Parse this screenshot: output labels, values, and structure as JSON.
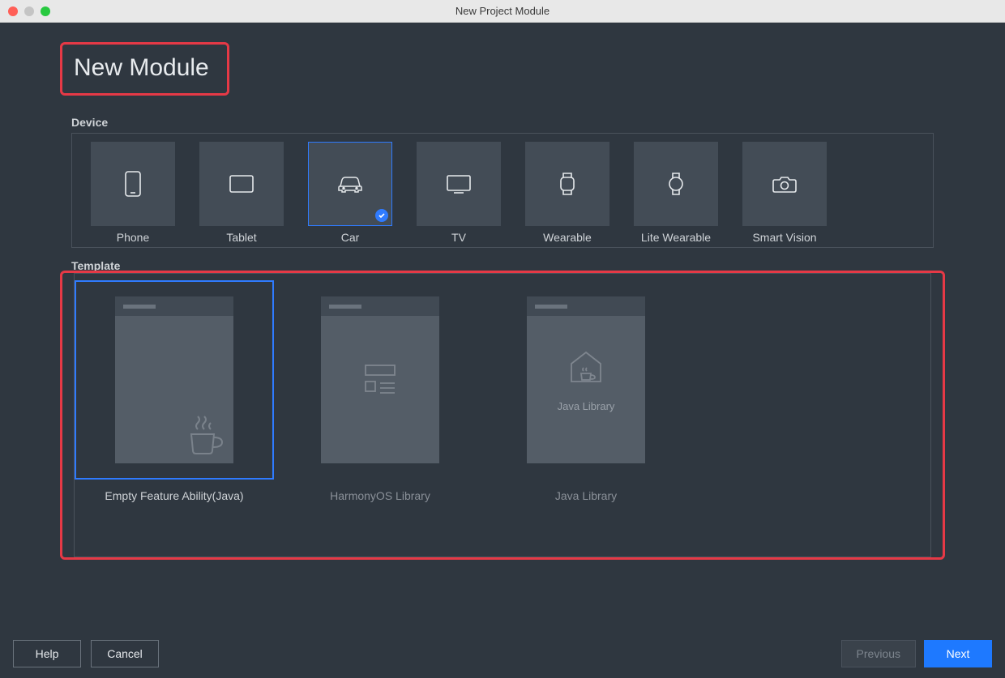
{
  "window": {
    "title": "New Project Module"
  },
  "heading": "New Module",
  "sections": {
    "device": "Device",
    "template": "Template"
  },
  "devices": [
    {
      "id": "phone",
      "label": "Phone",
      "selected": false
    },
    {
      "id": "tablet",
      "label": "Tablet",
      "selected": false
    },
    {
      "id": "car",
      "label": "Car",
      "selected": true
    },
    {
      "id": "tv",
      "label": "TV",
      "selected": false
    },
    {
      "id": "wearable",
      "label": "Wearable",
      "selected": false
    },
    {
      "id": "lite-wearable",
      "label": "Lite Wearable",
      "selected": false
    },
    {
      "id": "smart-vision",
      "label": "Smart Vision",
      "selected": false
    }
  ],
  "templates": [
    {
      "id": "empty-feature-java",
      "label": "Empty Feature Ability(Java)",
      "selected": true
    },
    {
      "id": "harmonyos-library",
      "label": "HarmonyOS Library",
      "selected": false
    },
    {
      "id": "java-library",
      "label": "Java Library",
      "inner_text": "Java Library",
      "selected": false
    }
  ],
  "footer": {
    "help": "Help",
    "cancel": "Cancel",
    "previous": "Previous",
    "next": "Next"
  },
  "colors": {
    "accent": "#1e79ff",
    "highlight": "#e63946",
    "panel": "#2f3740",
    "tile": "#434c56"
  }
}
